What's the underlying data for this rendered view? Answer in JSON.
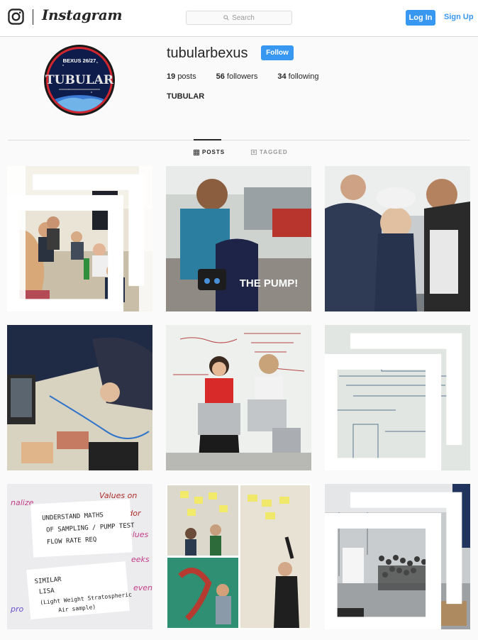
{
  "header": {
    "brand": "Instagram",
    "search_placeholder": "Search",
    "login_label": "Log In",
    "signup_label": "Sign Up",
    "accent_color": "#3897f0"
  },
  "profile": {
    "username": "tubularbexus",
    "follow_label": "Follow",
    "posts_count": "19",
    "posts_label": "posts",
    "followers_count": "56",
    "followers_label": "followers",
    "following_count": "34",
    "following_label": "following",
    "full_name": "TUBULAR",
    "avatar_text_top": "BEXUS 26/27",
    "avatar_text_main": "TUBULAR"
  },
  "tabs": [
    {
      "label": "POSTS",
      "icon": "grid-icon",
      "active": true
    },
    {
      "label": "TAGGED",
      "icon": "tag-icon",
      "active": false
    }
  ],
  "posts": [
    {
      "name": "post-group-selfie",
      "multi": true,
      "caption": ""
    },
    {
      "name": "post-the-pump",
      "multi": false,
      "caption": "THE PUMP!"
    },
    {
      "name": "post-smiling-students",
      "multi": false,
      "caption": ""
    },
    {
      "name": "post-laptops-desk",
      "multi": false,
      "caption": ""
    },
    {
      "name": "post-whiteboard-bags",
      "multi": false,
      "caption": ""
    },
    {
      "name": "post-whiteboard-equations",
      "multi": true,
      "caption": ""
    },
    {
      "name": "post-sticky-notes",
      "multi": false,
      "caption": "UNDERSTAND MATHS OF SAMPLING / PUMP TEST"
    },
    {
      "name": "post-collage-notes",
      "multi": false,
      "caption": ""
    },
    {
      "name": "post-crowd-hangar",
      "multi": true,
      "caption": ""
    }
  ]
}
